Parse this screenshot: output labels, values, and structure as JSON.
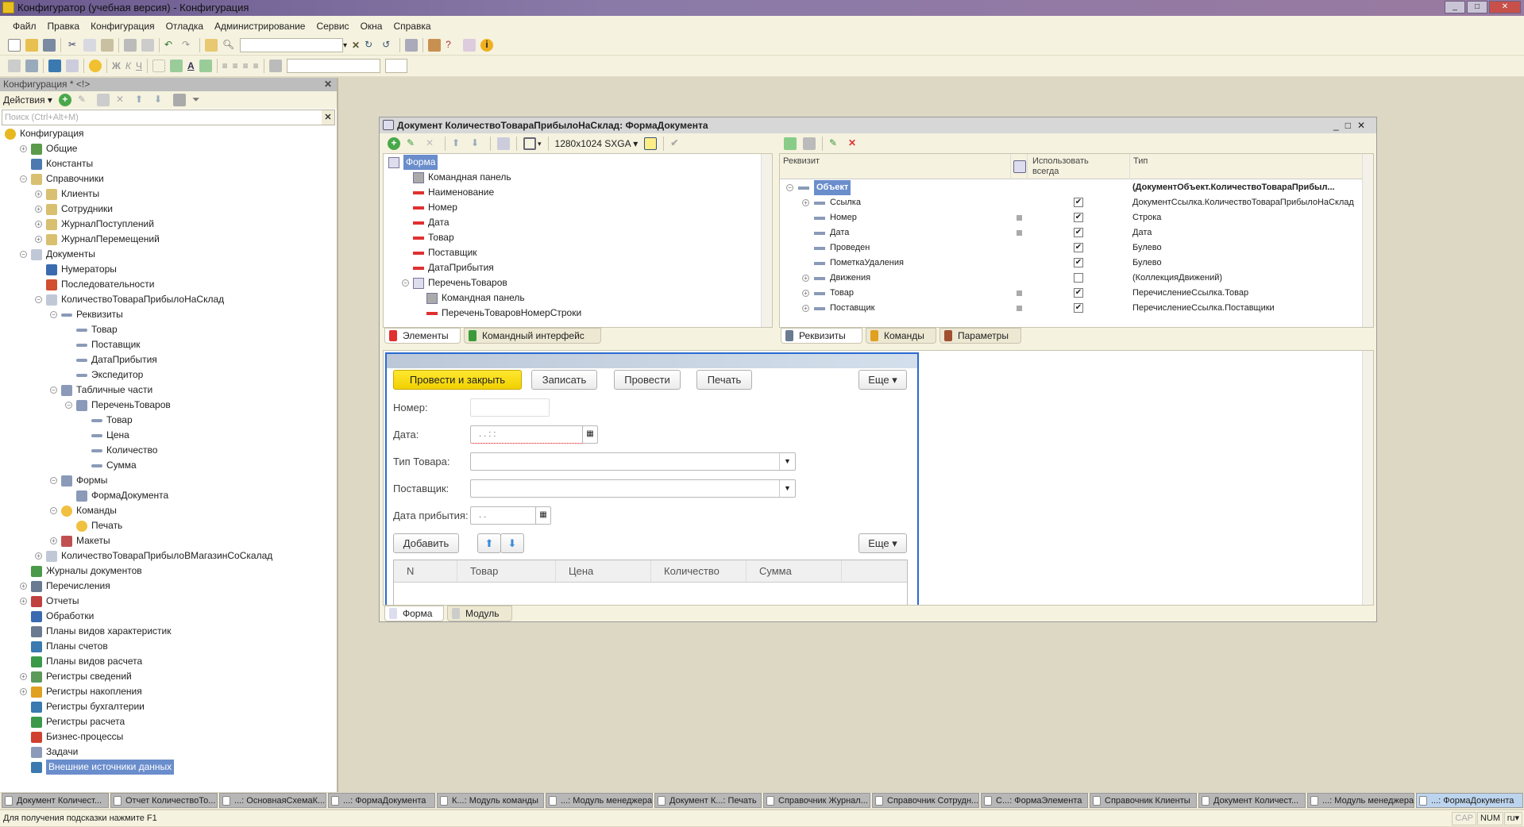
{
  "app": {
    "title": "Конфигуратор (учебная версия) - Конфигурация"
  },
  "menu": [
    "Файл",
    "Правка",
    "Конфигурация",
    "Отладка",
    "Администрирование",
    "Сервис",
    "Окна",
    "Справка"
  ],
  "left_panel": {
    "title": "Конфигурация * <!>",
    "actions_label": "Действия",
    "search_placeholder": "Поиск (Ctrl+Alt+M)",
    "tree": [
      {
        "label": "Конфигурация",
        "level": 0,
        "exp": "",
        "icon": "config-icon",
        "color": "#e8b820"
      },
      {
        "label": "Общие",
        "level": 1,
        "exp": "+",
        "icon": "common-icon",
        "color": "#5a9a4a"
      },
      {
        "label": "Константы",
        "level": 1,
        "exp": "",
        "icon": "constants-icon",
        "color": "#4a7ab0"
      },
      {
        "label": "Справочники",
        "level": 1,
        "exp": "-",
        "icon": "catalogs-icon",
        "color": "#d8c070"
      },
      {
        "label": "Клиенты",
        "level": 2,
        "exp": "+",
        "icon": "catalog-icon",
        "color": "#d8c070"
      },
      {
        "label": "Сотрудники",
        "level": 2,
        "exp": "+",
        "icon": "catalog-icon",
        "color": "#d8c070"
      },
      {
        "label": "ЖурналПоступлений",
        "level": 2,
        "exp": "+",
        "icon": "catalog-icon",
        "color": "#d8c070"
      },
      {
        "label": "ЖурналПеремещений",
        "level": 2,
        "exp": "+",
        "icon": "catalog-icon",
        "color": "#d8c070"
      },
      {
        "label": "Документы",
        "level": 1,
        "exp": "-",
        "icon": "documents-icon",
        "color": "#c0c8d8"
      },
      {
        "label": "Нумераторы",
        "level": 2,
        "exp": "",
        "icon": "numerators-icon",
        "color": "#3a6ab0"
      },
      {
        "label": "Последовательности",
        "level": 2,
        "exp": "",
        "icon": "sequences-icon",
        "color": "#d05030"
      },
      {
        "label": "КоличествоТовараПрибылоНаСклад",
        "level": 2,
        "exp": "-",
        "icon": "document-icon",
        "color": "#c0c8d8"
      },
      {
        "label": "Реквизиты",
        "level": 3,
        "exp": "-",
        "icon": "attribute-icon",
        "color": "#8a9ab8"
      },
      {
        "label": "Товар",
        "level": 4,
        "exp": "",
        "icon": "attribute-icon",
        "color": "#8a9ab8"
      },
      {
        "label": "Поставщик",
        "level": 4,
        "exp": "",
        "icon": "attribute-icon",
        "color": "#8a9ab8"
      },
      {
        "label": "ДатаПрибытия",
        "level": 4,
        "exp": "",
        "icon": "attribute-icon",
        "color": "#8a9ab8"
      },
      {
        "label": "Экспедитор",
        "level": 4,
        "exp": "",
        "icon": "attribute-icon",
        "color": "#8a9ab8"
      },
      {
        "label": "Табличные части",
        "level": 3,
        "exp": "-",
        "icon": "tabular-icon",
        "color": "#8a9ab8"
      },
      {
        "label": "ПереченьТоваров",
        "level": 4,
        "exp": "-",
        "icon": "tabular-icon",
        "color": "#8a9ab8"
      },
      {
        "label": "Товар",
        "level": 5,
        "exp": "",
        "icon": "attribute-icon",
        "color": "#8a9ab8"
      },
      {
        "label": "Цена",
        "level": 5,
        "exp": "",
        "icon": "attribute-icon",
        "color": "#8a9ab8"
      },
      {
        "label": "Количество",
        "level": 5,
        "exp": "",
        "icon": "attribute-icon",
        "color": "#8a9ab8"
      },
      {
        "label": "Сумма",
        "level": 5,
        "exp": "",
        "icon": "attribute-icon",
        "color": "#8a9ab8"
      },
      {
        "label": "Формы",
        "level": 3,
        "exp": "-",
        "icon": "forms-icon",
        "color": "#8a9ab8"
      },
      {
        "label": "ФормаДокумента",
        "level": 4,
        "exp": "",
        "icon": "form-icon",
        "color": "#8a9ab8"
      },
      {
        "label": "Команды",
        "level": 3,
        "exp": "-",
        "icon": "commands-icon",
        "color": "#f0c040"
      },
      {
        "label": "Печать",
        "level": 4,
        "exp": "",
        "icon": "command-icon",
        "color": "#f0c040"
      },
      {
        "label": "Макеты",
        "level": 3,
        "exp": "+",
        "icon": "templates-icon",
        "color": "#c05050"
      },
      {
        "label": "КоличествоТовараПрибылоВМагазинСоСкалад",
        "level": 2,
        "exp": "+",
        "icon": "document-icon",
        "color": "#c0c8d8"
      },
      {
        "label": "Журналы документов",
        "level": 1,
        "exp": "",
        "icon": "journals-icon",
        "color": "#4a9a4a"
      },
      {
        "label": "Перечисления",
        "level": 1,
        "exp": "+",
        "icon": "enums-icon",
        "color": "#6a7a90"
      },
      {
        "label": "Отчеты",
        "level": 1,
        "exp": "+",
        "icon": "reports-icon",
        "color": "#c04040"
      },
      {
        "label": "Обработки",
        "level": 1,
        "exp": "",
        "icon": "dataprocessors-icon",
        "color": "#3a6ab0"
      },
      {
        "label": "Планы видов характеристик",
        "level": 1,
        "exp": "",
        "icon": "chart-of-characteristic-types-icon",
        "color": "#6a7a90"
      },
      {
        "label": "Планы счетов",
        "level": 1,
        "exp": "",
        "icon": "chart-of-accounts-icon",
        "color": "#3a7ab0"
      },
      {
        "label": "Планы видов расчета",
        "level": 1,
        "exp": "",
        "icon": "chart-of-calculation-types-icon",
        "color": "#3a9a4a"
      },
      {
        "label": "Регистры сведений",
        "level": 1,
        "exp": "+",
        "icon": "information-registers-icon",
        "color": "#5a9a5a"
      },
      {
        "label": "Регистры накопления",
        "level": 1,
        "exp": "+",
        "icon": "accumulation-registers-icon",
        "color": "#e0a020"
      },
      {
        "label": "Регистры бухгалтерии",
        "level": 1,
        "exp": "",
        "icon": "accounting-registers-icon",
        "color": "#3a7ab0"
      },
      {
        "label": "Регистры расчета",
        "level": 1,
        "exp": "",
        "icon": "calculation-registers-icon",
        "color": "#3a9a4a"
      },
      {
        "label": "Бизнес-процессы",
        "level": 1,
        "exp": "",
        "icon": "business-processes-icon",
        "color": "#d04030"
      },
      {
        "label": "Задачи",
        "level": 1,
        "exp": "",
        "icon": "tasks-icon",
        "color": "#8a9ab8"
      },
      {
        "label": "Внешние источники данных",
        "level": 1,
        "exp": "",
        "icon": "external-data-sources-icon",
        "color": "#3a7ab0",
        "selected": true
      }
    ]
  },
  "doc": {
    "title": "Документ КоличествоТовараПрибылоНаСклад: ФормаДокумента",
    "resolution": "1280x1024 SXGA",
    "elements": [
      {
        "label": "Форма",
        "level": 0,
        "exp": "",
        "icon": "form-icon",
        "selected": true
      },
      {
        "label": "Командная панель",
        "level": 1,
        "exp": "",
        "icon": "command-bar-icon"
      },
      {
        "label": "Наименование",
        "level": 1,
        "exp": "",
        "icon": "field-icon"
      },
      {
        "label": "Номер",
        "level": 1,
        "exp": "",
        "icon": "field-icon"
      },
      {
        "label": "Дата",
        "level": 1,
        "exp": "",
        "icon": "field-icon"
      },
      {
        "label": "Товар",
        "level": 1,
        "exp": "",
        "icon": "field-icon"
      },
      {
        "label": "Поставщик",
        "level": 1,
        "exp": "",
        "icon": "field-icon"
      },
      {
        "label": "ДатаПрибытия",
        "level": 1,
        "exp": "",
        "icon": "field-icon"
      },
      {
        "label": "ПереченьТоваров",
        "level": 1,
        "exp": "-",
        "icon": "table-icon"
      },
      {
        "label": "Командная панель",
        "level": 2,
        "exp": "",
        "icon": "command-bar-icon"
      },
      {
        "label": "ПереченьТоваровНомерСтроки",
        "level": 2,
        "exp": "",
        "icon": "field-icon"
      }
    ],
    "left_tabs": [
      "Элементы",
      "Командный интерфейс"
    ],
    "attr_headers": [
      "Реквизит",
      "Использовать всегда",
      "Тип"
    ],
    "attrs": [
      {
        "name": "Объект",
        "level": 0,
        "exp": "-",
        "marker": false,
        "check": null,
        "type": "(ДокументОбъект.КоличествоТовараПрибыл...",
        "bold": true
      },
      {
        "name": "Ссылка",
        "level": 1,
        "exp": "+",
        "marker": false,
        "check": true,
        "type": "ДокументСсылка.КоличествоТовараПрибылоНаСклад"
      },
      {
        "name": "Номер",
        "level": 1,
        "exp": "",
        "marker": true,
        "check": true,
        "type": "Строка"
      },
      {
        "name": "Дата",
        "level": 1,
        "exp": "",
        "marker": true,
        "check": true,
        "type": "Дата"
      },
      {
        "name": "Проведен",
        "level": 1,
        "exp": "",
        "marker": false,
        "check": true,
        "type": "Булево"
      },
      {
        "name": "ПометкаУдаления",
        "level": 1,
        "exp": "",
        "marker": false,
        "check": true,
        "type": "Булево"
      },
      {
        "name": "Движения",
        "level": 1,
        "exp": "+",
        "marker": false,
        "check": false,
        "type": "(КоллекцияДвижений)"
      },
      {
        "name": "Товар",
        "level": 1,
        "exp": "+",
        "marker": true,
        "check": true,
        "type": "ПеречислениеСсылка.Товар"
      },
      {
        "name": "Поставщик",
        "level": 1,
        "exp": "+",
        "marker": true,
        "check": true,
        "type": "ПеречислениеСсылка.Поставщики"
      }
    ],
    "right_tabs": [
      "Реквизиты",
      "Команды",
      "Параметры"
    ],
    "preview": {
      "buttons": [
        "Провести и закрыть",
        "Записать",
        "Провести",
        "Печать",
        "Еще"
      ],
      "labels": {
        "number": "Номер:",
        "date": "Дата:",
        "product_type": "Тип Товара:",
        "supplier": "Поставщик:",
        "arrival": "Дата прибытия:"
      },
      "date_mask": ". .       : :",
      "arrival_mask": ". .",
      "table_buttons": {
        "add": "Добавить",
        "more": "Еще"
      },
      "columns": [
        "N",
        "Товар",
        "Цена",
        "Количество",
        "Сумма"
      ]
    },
    "bottom_tabs": [
      "Форма",
      "Модуль"
    ]
  },
  "taskbar": [
    {
      "label": "Документ Количест...",
      "active": false
    },
    {
      "label": "Отчет КоличествоТо...",
      "active": false
    },
    {
      "label": "...: ОсновнаяСхемаК...",
      "active": false
    },
    {
      "label": "...: ФормаДокумента",
      "active": false
    },
    {
      "label": "К...: Модуль команды",
      "active": false
    },
    {
      "label": "...: Модуль менеджера",
      "active": false
    },
    {
      "label": "Документ К...: Печать",
      "active": false
    },
    {
      "label": "Справочник Журнал...",
      "active": false
    },
    {
      "label": "Справочник Сотрудн...",
      "active": false
    },
    {
      "label": "С...: ФормаЭлемента",
      "active": false
    },
    {
      "label": "Справочник Клиенты",
      "active": false
    },
    {
      "label": "Документ Количест...",
      "active": false
    },
    {
      "label": "...: Модуль менеджера",
      "active": false
    },
    {
      "label": "...: ФормаДокумента",
      "active": true
    }
  ],
  "status": {
    "hint": "Для получения подсказки нажмите F1",
    "cap": "CAP",
    "num": "NUM",
    "lang": "ru"
  },
  "colors": {
    "accent_yellow": "#f5d800",
    "selection": "#6a8dcc",
    "form_border": "#2a6ad0"
  }
}
